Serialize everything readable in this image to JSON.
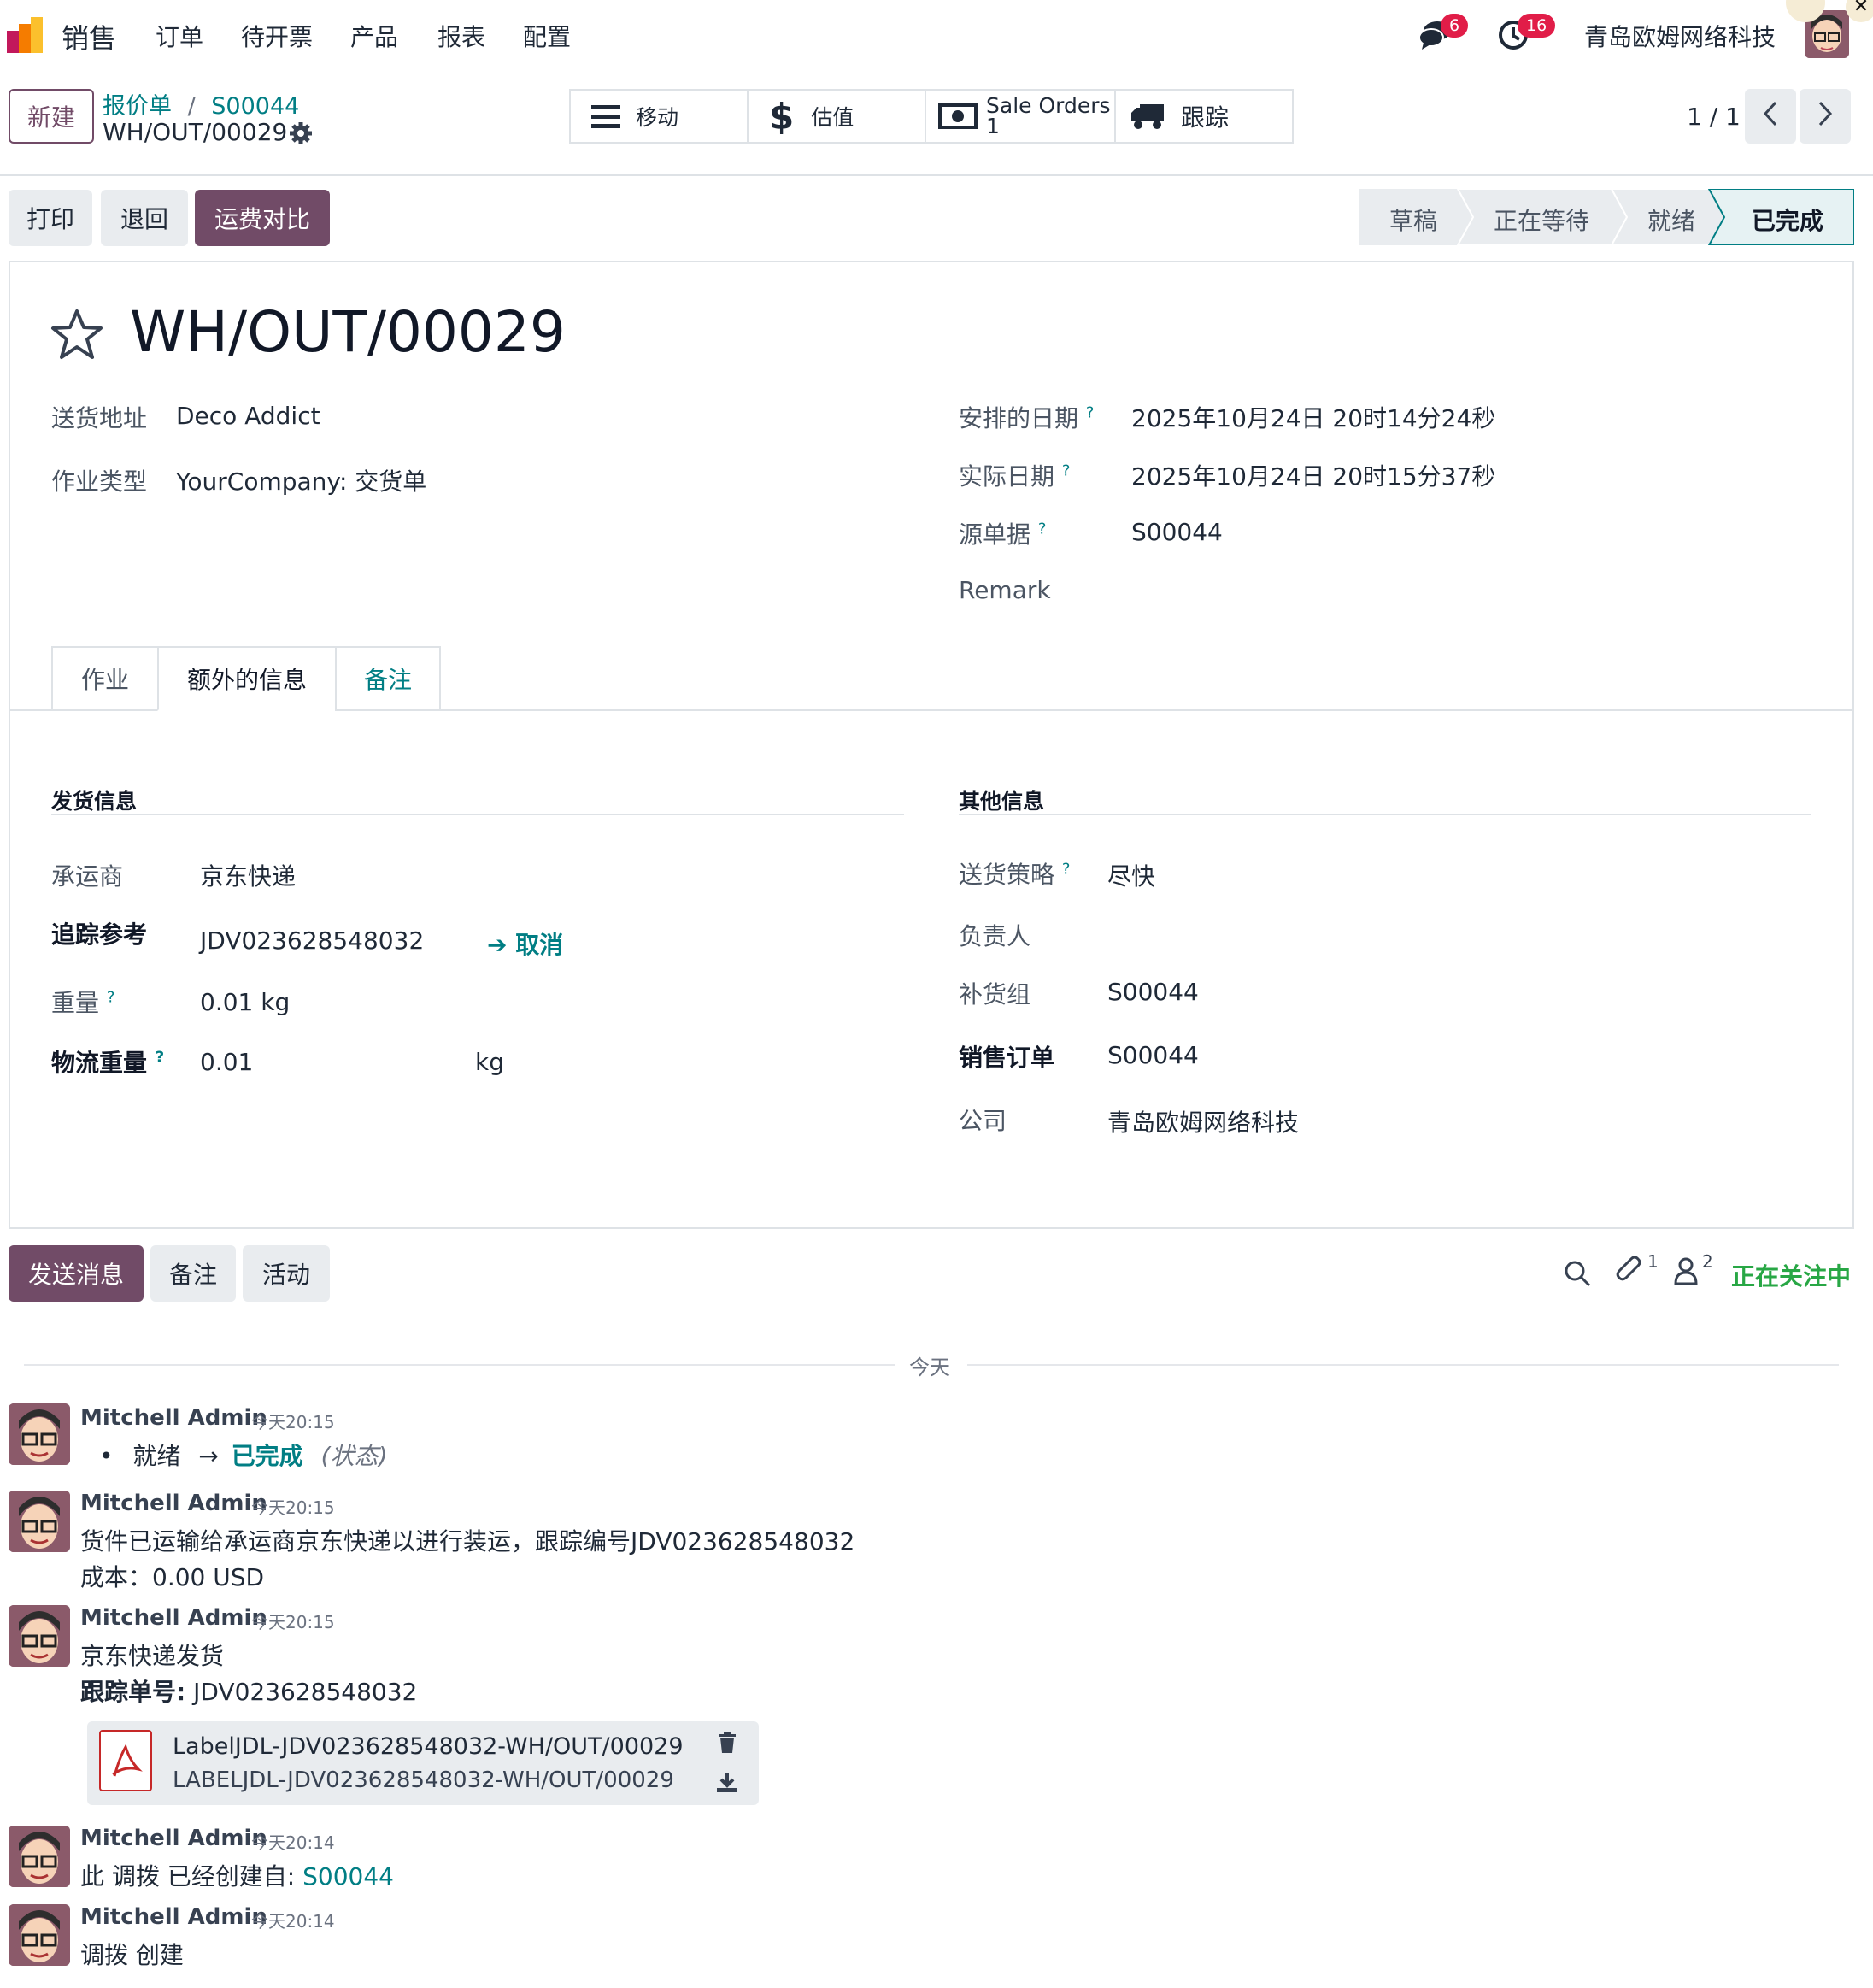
{
  "navbar": {
    "app_name": "销售",
    "menu": [
      "订单",
      "待开票",
      "产品",
      "报表",
      "配置"
    ],
    "messages_count": "6",
    "activities_count": "16",
    "company": "青岛欧姆网络科技",
    "more": "···",
    "close": "✕"
  },
  "control": {
    "new_label": "新建",
    "breadcrumb_parent": "报价单",
    "breadcrumb_sep": "/",
    "breadcrumb_order": "S00044",
    "record_name": "WH/OUT/00029",
    "smart_buttons": {
      "move": "移动",
      "valuation": "估值",
      "sale_orders_label": "Sale Orders",
      "sale_orders_count": "1",
      "tracking": "跟踪"
    },
    "pager": "1 / 1"
  },
  "actions": {
    "print": "打印",
    "return": "退回",
    "freight_compare": "运费对比"
  },
  "statusbar": [
    "草稿",
    "正在等待",
    "就绪",
    "已完成"
  ],
  "form": {
    "title": "WH/OUT/00029",
    "left_fields": {
      "delivery_address_label": "送货地址",
      "delivery_address_value": "Deco Addict",
      "operation_type_label": "作业类型",
      "operation_type_value": "YourCompany: 交货单"
    },
    "right_fields": {
      "scheduled_date_label": "安排的日期",
      "scheduled_date_value": "2025年10月24日 20时14分24秒",
      "effective_date_label": "实际日期",
      "effective_date_value": "2025年10月24日 20时15分37秒",
      "source_label": "源单据",
      "source_value": "S00044",
      "remark_label": "Remark"
    },
    "help_mark": "?",
    "tabs": [
      "作业",
      "额外的信息",
      "备注"
    ],
    "shipping": {
      "title": "发货信息",
      "carrier_label": "承运商",
      "carrier_value": "京东快递",
      "tracking_label": "追踪参考",
      "tracking_value": "JDV023628548032",
      "cancel_label": "取消",
      "weight_label": "重量",
      "weight_value": "0.01 kg",
      "shipping_weight_label": "物流重量",
      "shipping_weight_value": "0.01",
      "shipping_weight_unit": "kg"
    },
    "other": {
      "title": "其他信息",
      "policy_label": "送货策略",
      "policy_value": "尽快",
      "responsible_label": "负责人",
      "group_label": "补货组",
      "group_value": "S00044",
      "sale_order_label": "销售订单",
      "sale_order_value": "S00044",
      "company_label": "公司",
      "company_value": "青岛欧姆网络科技"
    }
  },
  "chatter": {
    "send_message": "发送消息",
    "log_note": "备注",
    "activity": "活动",
    "attachments_count": "1",
    "followers_count": "2",
    "following": "正在关注中",
    "today": "今天",
    "messages": [
      {
        "author": "Mitchell Admin",
        "time": "今天20:15",
        "from": "就绪",
        "arrow": "→",
        "to": "已完成",
        "field": "(状态)"
      },
      {
        "author": "Mitchell Admin",
        "time": "今天20:15",
        "line1": "货件已运输给承运商京东快递以进行装运，跟踪编号JDV023628548032",
        "line2": "成本：0.00 USD"
      },
      {
        "author": "Mitchell Admin",
        "time": "今天20:15",
        "line1": "京东快递发货",
        "line2_bold": "跟踪单号:",
        "line2_rest": " JDV023628548032",
        "attachment_name": "LabelJDL-JDV023628548032-WH/OUT/00029",
        "attachment_sub": "LABELJDL-JDV023628548032-WH/OUT/00029"
      },
      {
        "author": "Mitchell Admin",
        "time": "今天20:14",
        "text": "此 调拨 已经创建自: ",
        "link": "S00044"
      },
      {
        "author": "Mitchell Admin",
        "time": "今天20:14",
        "text": "调拨 创建"
      }
    ]
  }
}
